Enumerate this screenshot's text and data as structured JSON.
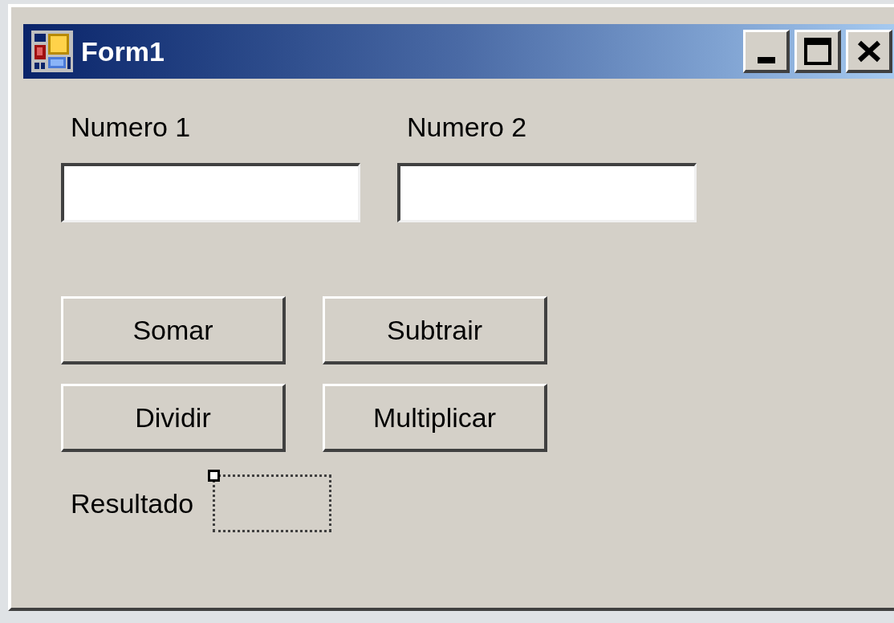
{
  "window": {
    "title": "Form1",
    "controls": [
      {
        "kind": "minimize"
      },
      {
        "kind": "maximize"
      },
      {
        "kind": "close"
      }
    ]
  },
  "fields": [
    {
      "label": "Numero 1"
    },
    {
      "label": "Numero 2"
    }
  ],
  "buttons": [
    [
      "Somar",
      "Subtrair"
    ],
    [
      "Dividir",
      "Multiplicar"
    ]
  ],
  "result": {
    "label": "Resultado",
    "selected": true
  }
}
